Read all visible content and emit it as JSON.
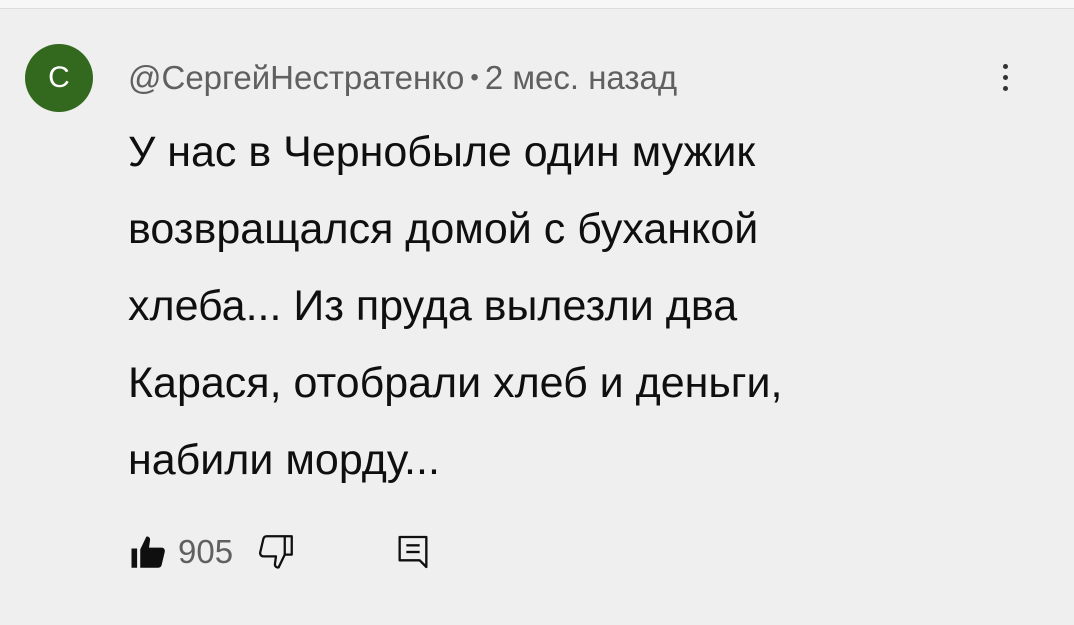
{
  "comment": {
    "avatar_letter": "С",
    "author": "@СергейНестратенко",
    "separator": "•",
    "time": "2 мес. назад",
    "text_lines": [
      "У нас в Чернобыле один мужик",
      "возвращался домой с буханкой",
      "хлеба... Из пруда вылезли два",
      "Карася, отобрали хлеб и деньги,",
      "набили морду..."
    ],
    "like_count": "905"
  },
  "icons": {
    "like": "thumbs-up-filled-icon",
    "dislike": "thumbs-down-outline-icon",
    "reply": "reply-comment-icon",
    "menu": "more-vertical-icon"
  },
  "colors": {
    "background": "#efefef",
    "avatar": "#33691e",
    "meta_text": "#606060",
    "body_text": "#0f0f0f"
  }
}
